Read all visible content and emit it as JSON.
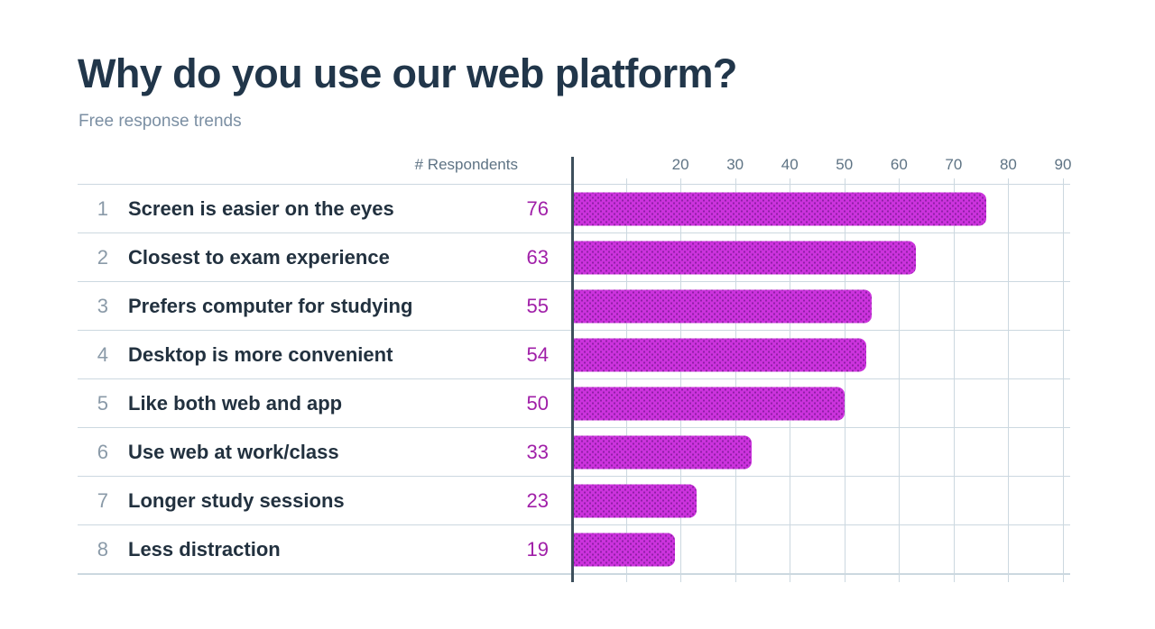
{
  "header": {
    "title": "Why do you use our web platform?",
    "subtitle": "Free response trends"
  },
  "axis": {
    "value_column_header": "# Respondents",
    "tick_labels": [
      "20",
      "30",
      "40",
      "50",
      "60",
      "70",
      "80",
      "90"
    ]
  },
  "colors": {
    "title": "#21364a",
    "subtitle": "#7b8fa3",
    "label": "#22313f",
    "rank": "#8a9aa8",
    "value": "#a01fa8",
    "bar_fill": "#cc33dd",
    "bar_dots": "#8f1fa6",
    "gridline": "#ccd8e0",
    "zero_axis": "#3d4f5c",
    "background": "#ffffff"
  },
  "rows": [
    {
      "rank": "1",
      "label": "Screen is easier on the eyes",
      "value": "76",
      "emphasis": "bold"
    },
    {
      "rank": "2",
      "label": "Closest to exam experience",
      "value": "63",
      "emphasis": "bold"
    },
    {
      "rank": "3",
      "label": "Prefers computer for studying",
      "value": "55",
      "emphasis": "bold"
    },
    {
      "rank": "4",
      "label": "Desktop is more convenient",
      "value": "54",
      "emphasis": "bold"
    },
    {
      "rank": "5",
      "label": "Like both web and app",
      "value": "50",
      "emphasis": "semi"
    },
    {
      "rank": "6",
      "label": "Use web at work/class",
      "value": "33",
      "emphasis": "semi"
    },
    {
      "rank": "7",
      "label": "Longer study sessions",
      "value": "23",
      "emphasis": "semi"
    },
    {
      "rank": "8",
      "label": "Less distraction",
      "value": "19",
      "emphasis": "semi"
    }
  ],
  "chart_data": {
    "type": "bar",
    "orientation": "horizontal",
    "title": "Why do you use our web platform?",
    "subtitle": "Free response trends",
    "xlabel": "# Respondents",
    "ylabel": "",
    "categories": [
      "Screen is easier on the eyes",
      "Closest to exam experience",
      "Prefers computer for studying",
      "Desktop is more convenient",
      "Like both web and app",
      "Use web at work/class",
      "Longer study sessions",
      "Less distraction"
    ],
    "values": [
      76,
      63,
      55,
      54,
      50,
      33,
      23,
      19
    ],
    "ranks": [
      1,
      2,
      3,
      4,
      5,
      6,
      7,
      8
    ],
    "xlim": [
      0,
      90
    ],
    "xticks": [
      20,
      30,
      40,
      50,
      60,
      70,
      80,
      90
    ],
    "xtick_step": 10,
    "grid": true,
    "grid_axis": "x",
    "legend": false,
    "bar_pattern": "polka-dots",
    "data_labels_shown": true
  }
}
